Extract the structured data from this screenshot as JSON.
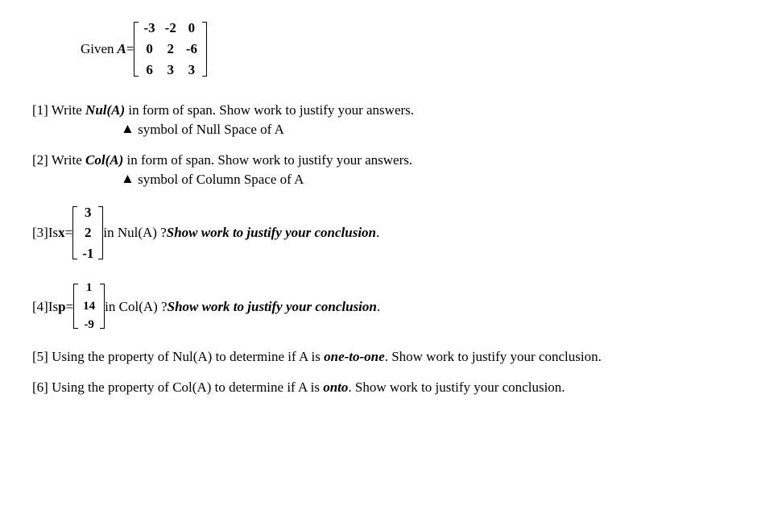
{
  "given": {
    "label_prefix": "Given  ",
    "symbol": "A",
    "equals": "=",
    "matrix": [
      "-3",
      "-2",
      "0",
      "0",
      "2",
      "-6",
      "6",
      "3",
      "3"
    ]
  },
  "q1": {
    "num": "[1]",
    "prefix": " Write ",
    "term": "Nul(A)",
    "rest": " in form of span.  Show work to justify your answers.",
    "hint_symbol": "▲",
    "hint_text": " symbol of Null Space of A"
  },
  "q2": {
    "num": "[2]",
    "prefix": " Write ",
    "term": "Col(A)",
    "rest": " in form of span.  Show work to justify your answers.",
    "hint_symbol": "▲",
    "hint_text": " symbol of Column Space of A"
  },
  "q3": {
    "num": "[3]",
    "prefix": " Is ",
    "var": "x",
    "equals": " =",
    "vector": [
      "3",
      "2",
      "-1"
    ],
    "mid": " in Nul(A) ?  ",
    "conclusion": "Show work to justify your conclusion",
    "period": "."
  },
  "q4": {
    "num": "[4]",
    "prefix": " Is ",
    "var": "p",
    "equals": "=",
    "vector": [
      "1",
      "14",
      "-9"
    ],
    "mid": " in Col(A) ?  ",
    "conclusion": "Show work to justify your conclusion",
    "period": "."
  },
  "q5": {
    "num": "[5]",
    "prefix": " Using the property of Nul(A) to determine if A is ",
    "term": "one-to-one",
    "rest": ".  Show work to justify your conclusion."
  },
  "q6": {
    "num": "[6]",
    "prefix": " Using the property of Col(A) to determine if A is ",
    "term": "onto",
    "rest": ".  Show work to justify your conclusion."
  },
  "bracket_heights": {
    "mat3x3": "66px",
    "vec3a": "64px",
    "vec3b": "54px",
    "tick": "5px"
  }
}
